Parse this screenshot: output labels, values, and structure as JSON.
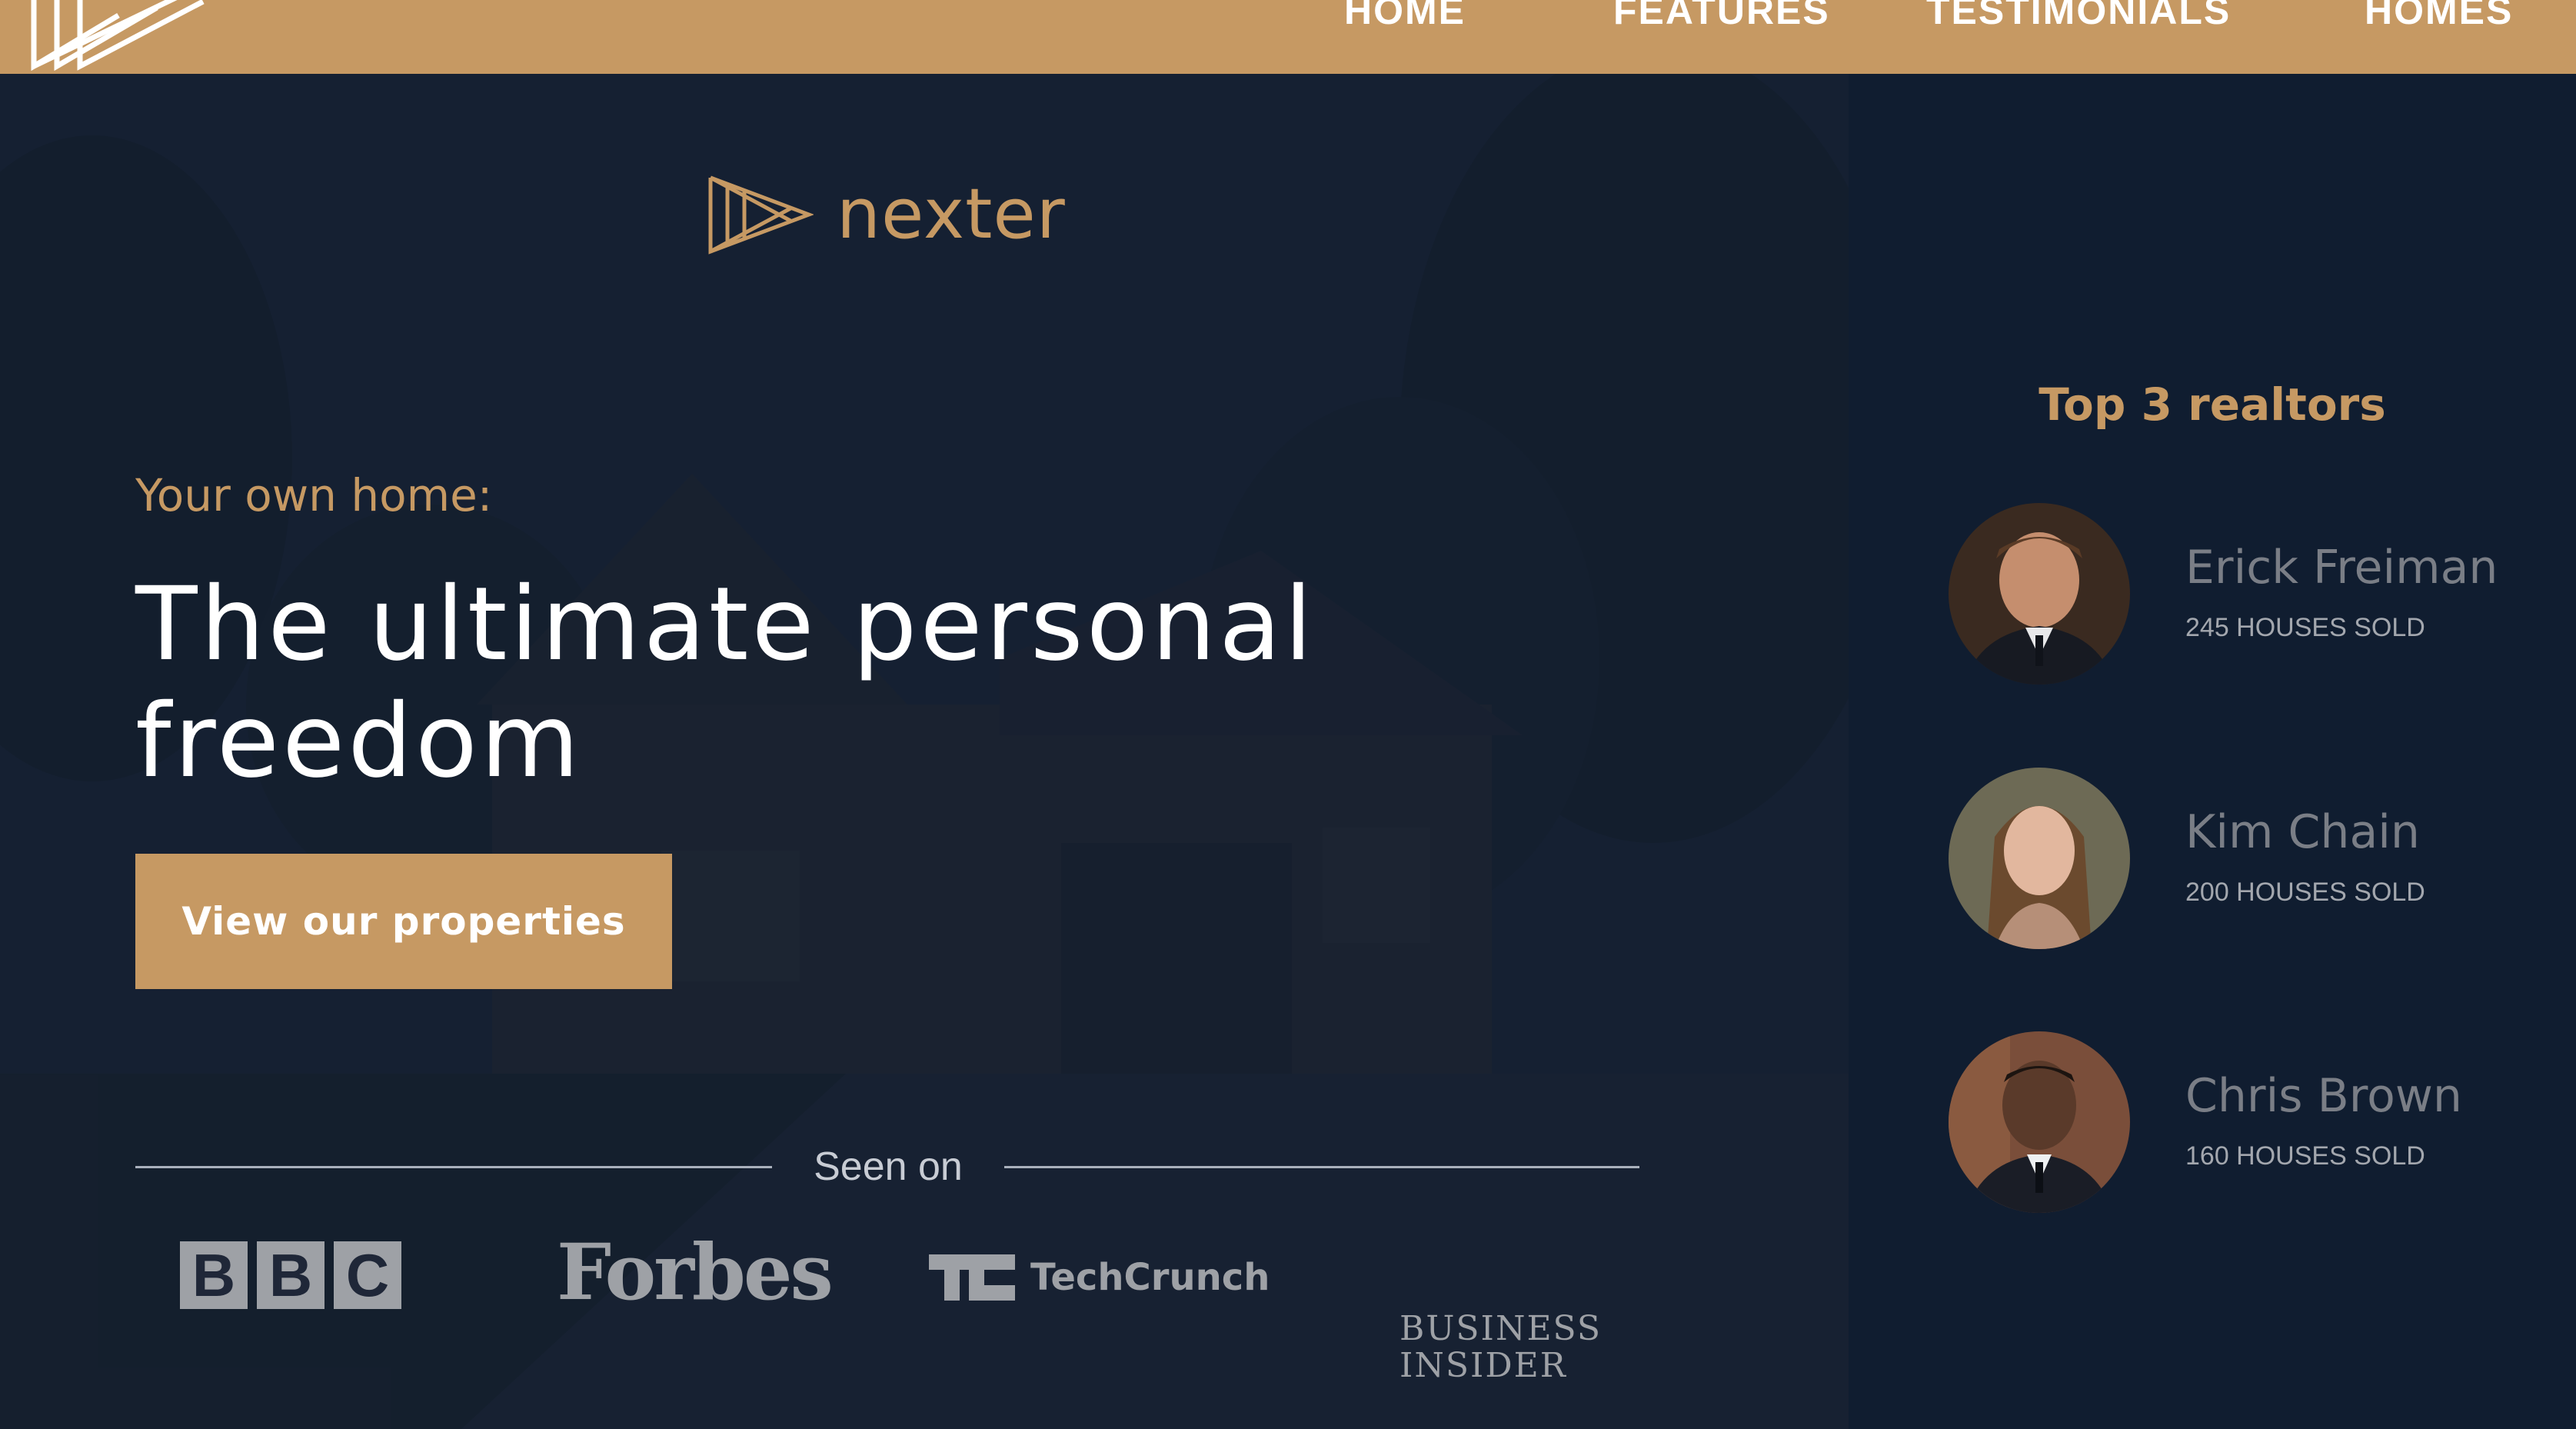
{
  "nav": {
    "logo_icon": "triangles-logo-icon",
    "links": [
      "HOME",
      "FEATURES",
      "TESTIMONIALS",
      "HOMES"
    ]
  },
  "hero": {
    "brand": {
      "icon": "nexter-triangles-icon",
      "name": "nexter"
    },
    "subtitle": "Your own home:",
    "title": "The ultimate personal freedom",
    "cta_label": "View our properties",
    "seen_on_label": "Seen on",
    "press_logos": {
      "bbc": [
        "B",
        "B",
        "C"
      ],
      "forbes": "Forbes",
      "techcrunch": "TechCrunch",
      "business_insider": [
        "BUSINESS",
        "INSIDER"
      ]
    }
  },
  "realtors": {
    "title": "Top 3 realtors",
    "items": [
      {
        "name": "Erick Freiman",
        "sold": "245 HOUSES SOLD",
        "avatar": "realtor-photo"
      },
      {
        "name": "Kim Chain",
        "sold": "200 HOUSES SOLD",
        "avatar": "realtor-photo"
      },
      {
        "name": "Chris Brown",
        "sold": "160 HOUSES SOLD",
        "avatar": "realtor-photo"
      }
    ]
  },
  "colors": {
    "accent": "#c69963",
    "hero_bg": "#1d2638",
    "sidebar_bg": "#101d30",
    "white": "#ffffff"
  }
}
